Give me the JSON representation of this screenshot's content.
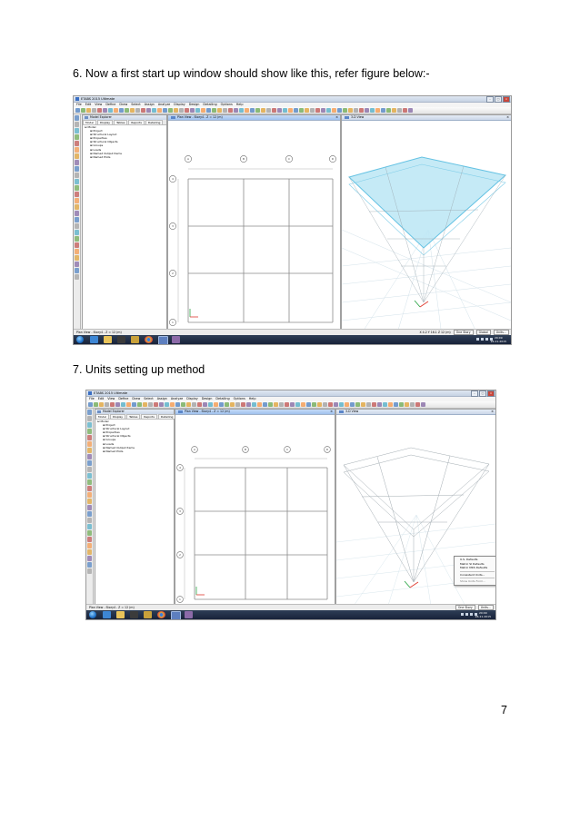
{
  "document": {
    "step6_heading": "6. Now a first start up window should show like this, refer figure below:-",
    "step7_heading": "7. Units setting up method",
    "page_number": "7"
  },
  "app": {
    "title": "ETABS 2015 Ultimate",
    "menu": [
      "File",
      "Edit",
      "View",
      "Define",
      "Draw",
      "Select",
      "Assign",
      "Analyze",
      "Display",
      "Design",
      "Detailing",
      "Options",
      "Help"
    ],
    "model_explorer": {
      "title": "Model Explorer",
      "tabs": [
        "Model",
        "Display",
        "Tables",
        "Reports",
        "Detailing"
      ],
      "tree_root": "Model",
      "tree_items": [
        "Project",
        "Structural Layout",
        "Properties",
        "Structural Objects",
        "Groups",
        "Loads",
        "Named Output Items",
        "Named Plots"
      ]
    },
    "plan_view_title": "Plan View - Story4 - Z = 12 (m)",
    "view_3d_title": "3-D View",
    "grid_labels": {
      "columns": [
        "A",
        "B",
        "C",
        "D"
      ],
      "rows": [
        "1",
        "2",
        "3",
        "4"
      ]
    },
    "status_left": "Plan View - Story4 - Z = 12 (m)",
    "coordinates": "X 4.2  Y 16.1  Z 12 (m)",
    "story_select": "One Story",
    "coord_select": "Global",
    "units_button": "Units...",
    "clock_time": "20:09",
    "clock_date": "26-11-2015",
    "units_menu": [
      "U.S. Defaults",
      "Metric SI Defaults",
      "Metric MKS Defaults",
      "Consistent Units...",
      "Show Units Form..."
    ]
  },
  "colors": {
    "slab": "#bfe8f6",
    "slab_edge": "#55bce0",
    "grid": "#8a8a8a",
    "window_frame": "#f0f0f0",
    "taskbar": "#1f2c44"
  }
}
